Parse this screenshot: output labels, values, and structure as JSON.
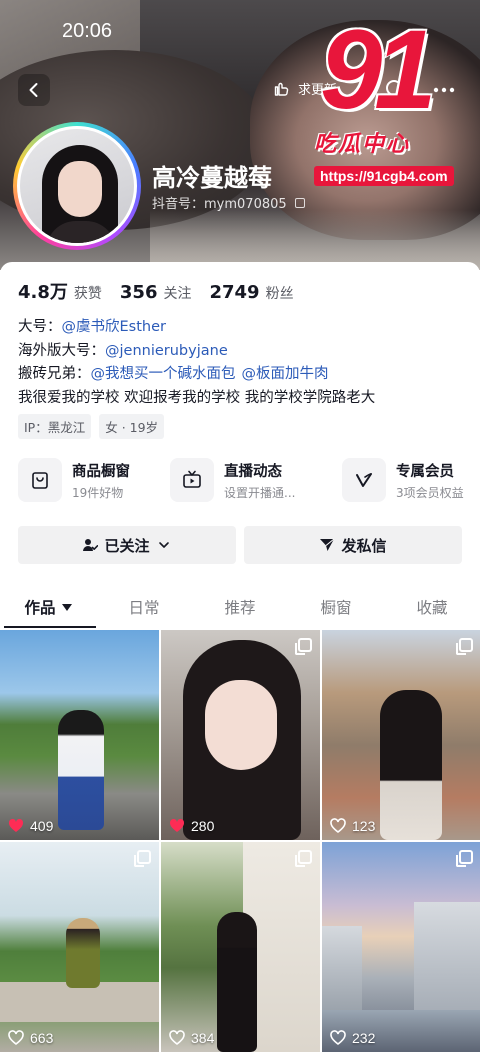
{
  "status_bar": {
    "time": "20:06"
  },
  "header": {
    "follow_label": "求更新",
    "watermark": {
      "number": "91",
      "subtitle": "吃瓜中心",
      "url": "https://91cgb4.com"
    }
  },
  "profile": {
    "nickname": "高冷蔓越莓",
    "douyin_id": "抖音号：mym070805"
  },
  "stats": [
    {
      "value": "4.8万",
      "label": "获赞"
    },
    {
      "value": "356",
      "label": "关注"
    },
    {
      "value": "2749",
      "label": "粉丝"
    }
  ],
  "bio": {
    "line1_prefix": "大号：",
    "line1_tag": "@虞书欣Esther",
    "line2_prefix": "海外版大号：",
    "line2_tag": "@jennierubyjane",
    "line3_prefix": "搬砖兄弟：",
    "line3_tag1": "@我想买一个碱水面包",
    "line3_tag2": "@板面加牛肉",
    "line4": "我很爱我的学校 欢迎报考我的学校 我的学校学院路老大"
  },
  "chips": [
    "IP：黑龙江",
    "女 · 19岁"
  ],
  "services": [
    {
      "icon": "shop-bag-icon",
      "title": "商品橱窗",
      "sub": "19件好物"
    },
    {
      "icon": "tv-icon",
      "title": "直播动态",
      "sub": "设置开播通..."
    },
    {
      "icon": "v-member-icon",
      "title": "专属会员",
      "sub": "3项会员权益"
    }
  ],
  "actions": {
    "followed": "已关注",
    "message": "发私信"
  },
  "tabs": [
    "作品",
    "日常",
    "推荐",
    "橱窗",
    "收藏"
  ],
  "posts": [
    {
      "likes": "409",
      "liked": true,
      "multi": false
    },
    {
      "likes": "280",
      "liked": true,
      "multi": true
    },
    {
      "likes": "123",
      "liked": false,
      "multi": true
    },
    {
      "likes": "663",
      "liked": false,
      "multi": true
    },
    {
      "likes": "384",
      "liked": false,
      "multi": true
    },
    {
      "likes": "232",
      "liked": false,
      "multi": true
    }
  ],
  "colors": {
    "accent_red": "#fe2c55",
    "link_blue": "#2c5bb8",
    "watermark_red": "#e8163b"
  }
}
